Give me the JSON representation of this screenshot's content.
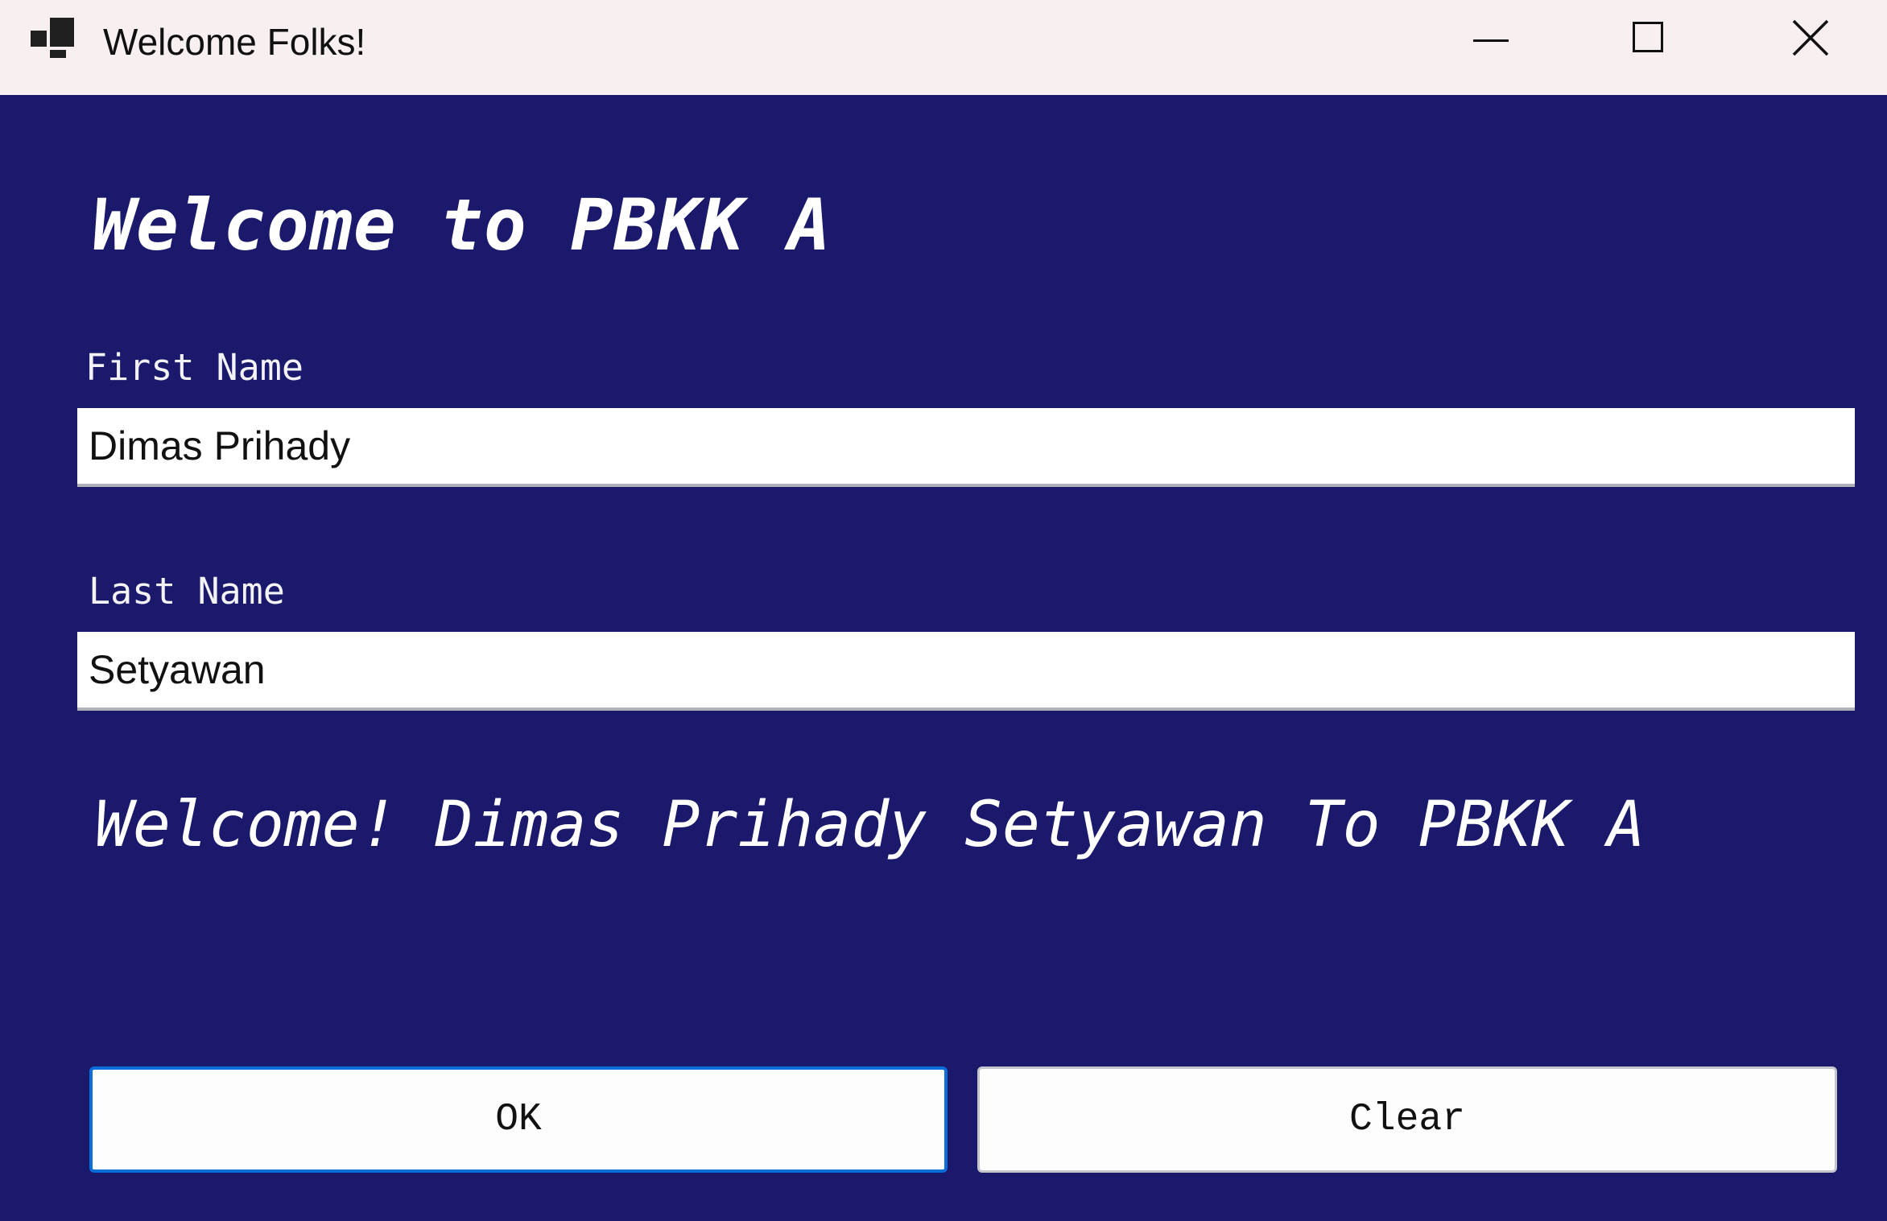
{
  "window": {
    "title": "Welcome Folks!",
    "app_icon": "app-form-icon",
    "controls": {
      "minimize_icon": "minimize-icon",
      "maximize_icon": "maximize-icon",
      "close_icon": "close-icon"
    }
  },
  "form": {
    "heading": "Welcome to PBKK A",
    "first_name": {
      "label": "First Name",
      "value": "Dimas Prihady"
    },
    "last_name": {
      "label": "Last Name",
      "value": "Setyawan"
    },
    "welcome_message": "Welcome! Dimas Prihady Setyawan To PBKK A",
    "buttons": {
      "ok_label": "OK",
      "clear_label": "Clear"
    }
  },
  "colors": {
    "background": "#1b196c",
    "titlebar": "#f8eff1",
    "accent_focus": "#0a6ed8",
    "text_light": "#ffffff"
  }
}
